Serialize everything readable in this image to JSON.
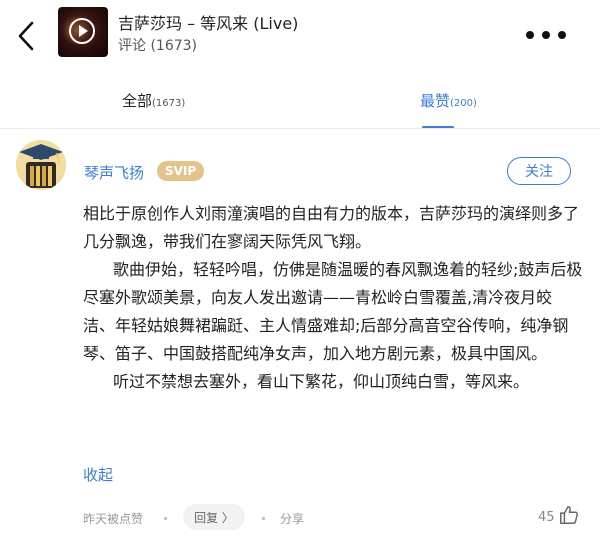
{
  "header": {
    "title": "吉萨莎玛 – 等风来 (Live)",
    "subtitle": "评论 (1673)",
    "icons": {
      "back": "back-arrow-icon",
      "play": "play-icon",
      "more": "more-dots-icon"
    }
  },
  "tabs": [
    {
      "label": "全部",
      "count": "(1673)",
      "active": false
    },
    {
      "label": "最赞",
      "count": "(200)",
      "active": true
    }
  ],
  "comment": {
    "username": "琴声飞扬",
    "badge": "SVIP",
    "follow_label": "关注",
    "paragraphs": [
      "相比于原创作人刘雨潼演唱的自由有力的版本，吉萨莎玛的演绎则多了几分飘逸，带我们在寥阔天际凭风飞翔。",
      "歌曲伊始，轻轻吟唱，仿佛是随温暖的春风飘逸着的轻纱;鼓声后极尽塞外歌颂美景，向友人发出邀请——青松岭白雪覆盖,清冷夜月皎洁、年轻姑娘舞裙蹁跹、主人情盛难却;后部分高音空谷传响，纯净钢琴、笛子、中国鼓搭配纯净女声，加入地方剧元素，极具中国风。",
      "听过不禁想去塞外，看山下繁花，仰山顶纯白雪，等风来。"
    ],
    "collapse_label": "收起",
    "footer": {
      "time": "昨天被点赞",
      "reply_label": "回复 〉",
      "share_label": "分享",
      "likes": "45"
    }
  },
  "colors": {
    "accent": "#3b7dd8",
    "svip": "#e2c48b",
    "text": "#222222",
    "muted": "#999999"
  }
}
